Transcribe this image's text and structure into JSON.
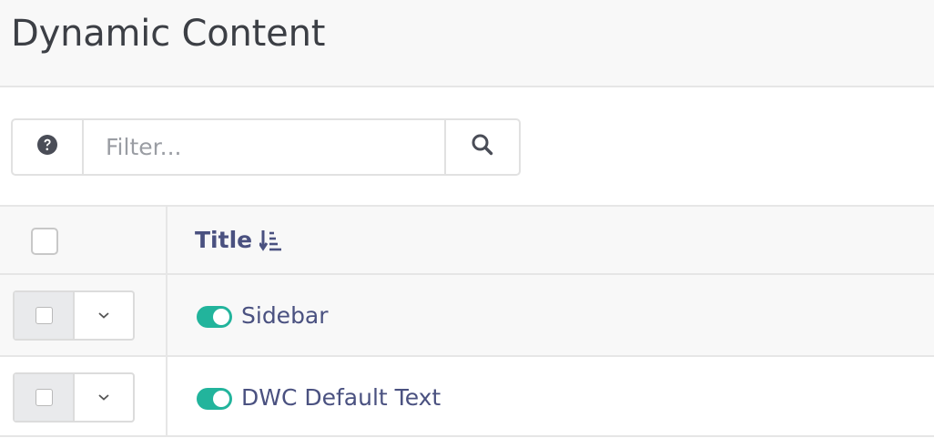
{
  "header": {
    "title": "Dynamic Content"
  },
  "filter": {
    "placeholder": "Filter..."
  },
  "table": {
    "columns": [
      {
        "label": "Title"
      }
    ],
    "rows": [
      {
        "title": "Sidebar",
        "published": true
      },
      {
        "title": "DWC Default Text",
        "published": true
      }
    ]
  },
  "colors": {
    "accent": "#22b49c",
    "link": "#4a5180",
    "title_text": "#3c3f45"
  }
}
